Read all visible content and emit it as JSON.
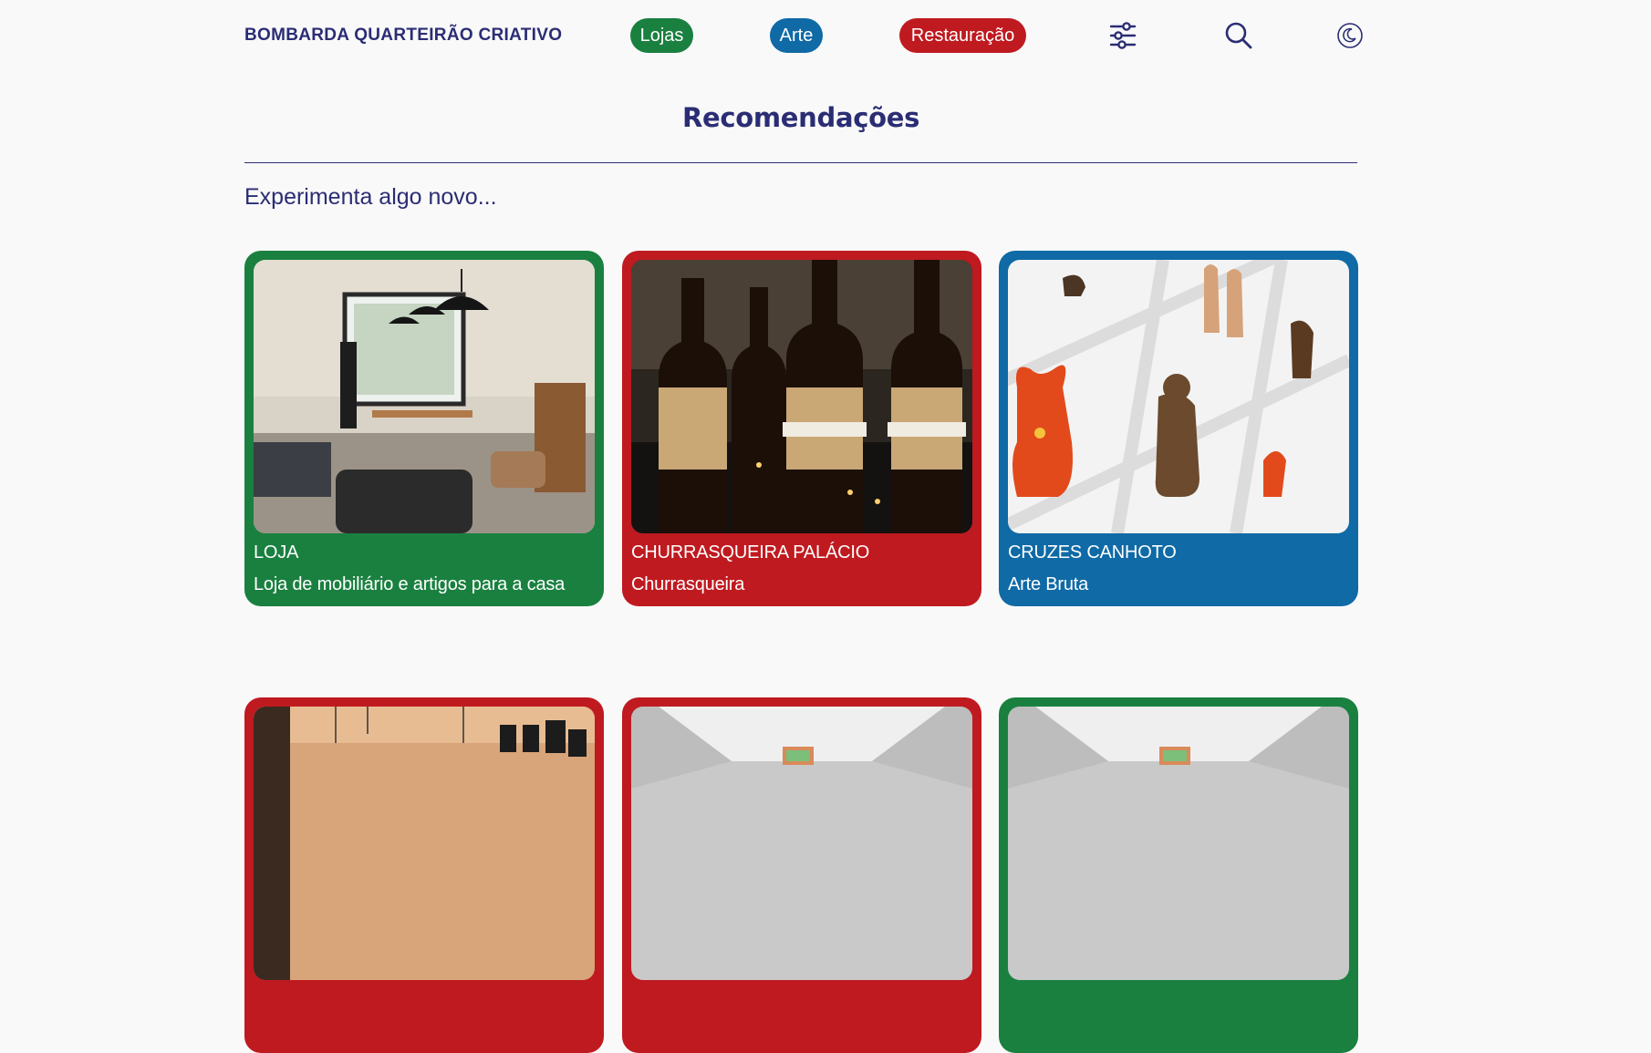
{
  "header": {
    "brand": "BOMBARDA QUARTEIRÃO CRIATIVO",
    "tabs": [
      {
        "label": "Lojas",
        "color": "#1a8040"
      },
      {
        "label": "Arte",
        "color": "#0f6aa6"
      },
      {
        "label": "Restauração",
        "color": "#bf1a20"
      }
    ],
    "icons": [
      "filter-icon",
      "search-icon",
      "moon-icon"
    ]
  },
  "main": {
    "title": "Recomendações",
    "subtitle": "Experimenta algo novo...",
    "cards": [
      {
        "name": "LOJA",
        "description": "Loja de mobiliário e artigos para a casa",
        "color": "#1a8040",
        "image": "furniture-store-photo"
      },
      {
        "name": "CHURRASQUEIRA PALÁCIO",
        "description": "Churrasqueira",
        "color": "#bf1a20",
        "image": "beer-bottles-photo"
      },
      {
        "name": "CRUZES CANHOTO",
        "description": "Arte Bruta",
        "color": "#0f6aa6",
        "image": "folk-art-figures-photo"
      },
      {
        "color": "#bf1a20",
        "image": "restaurant-interior-photo"
      },
      {
        "color": "#bf1a20",
        "image": "gallery-ceiling-photo"
      },
      {
        "color": "#1a8040",
        "image": "gallery-ceiling-photo"
      }
    ]
  }
}
